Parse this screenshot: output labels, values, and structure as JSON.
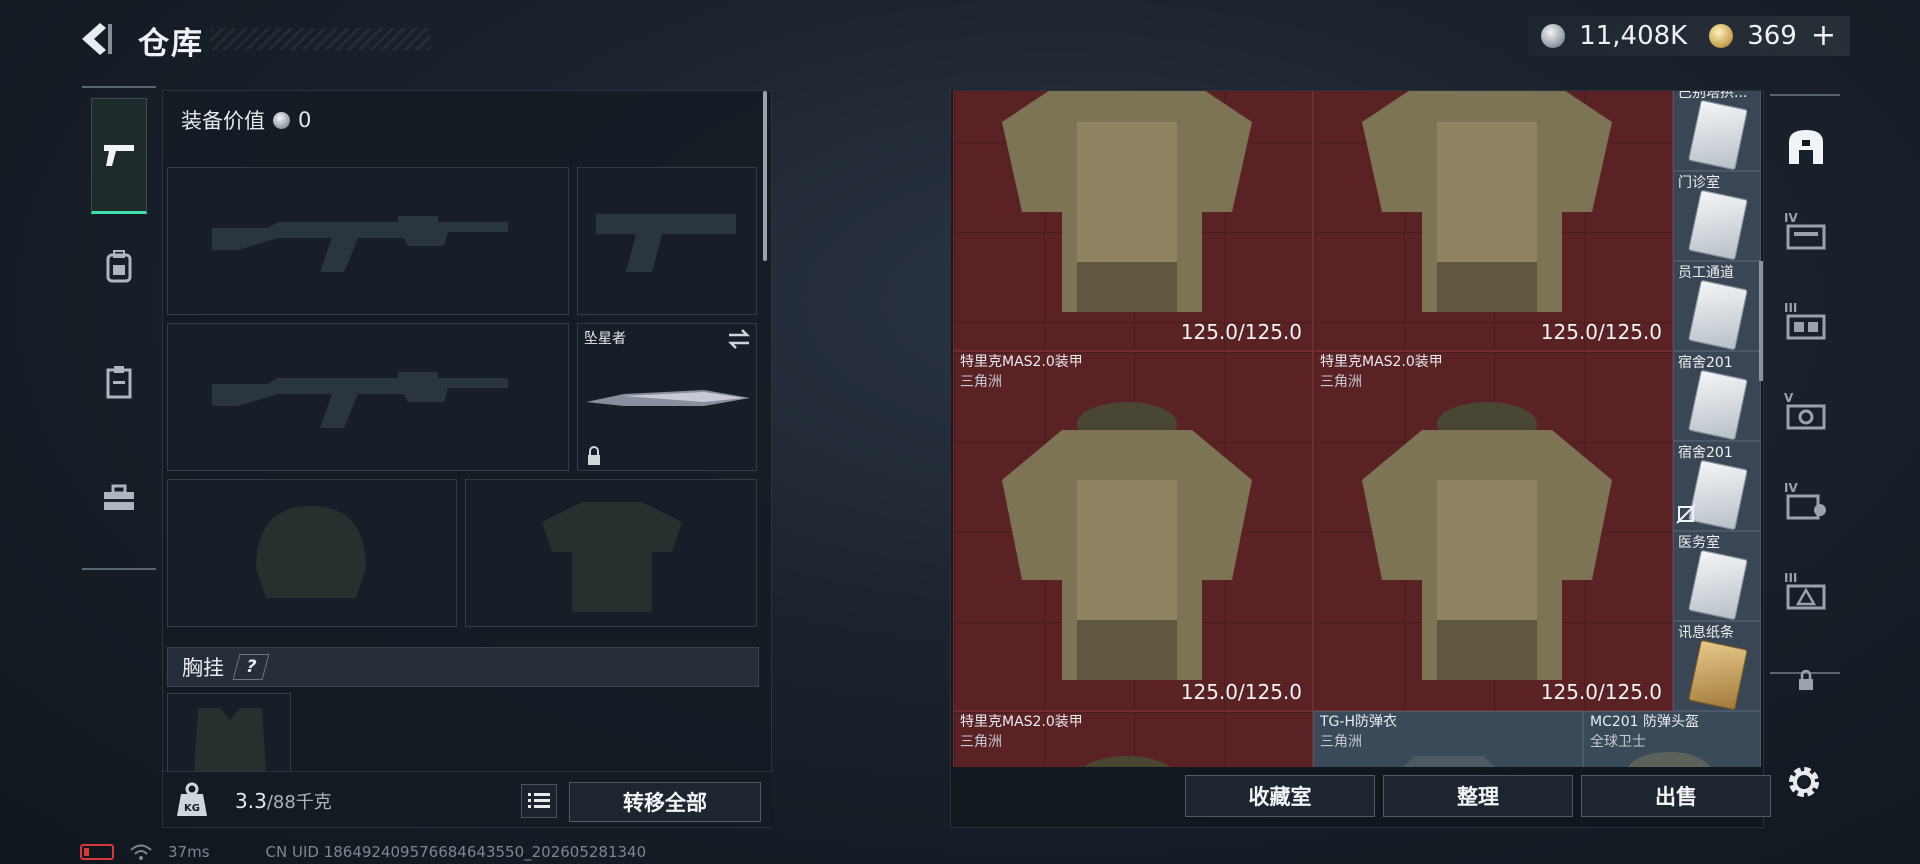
{
  "header": {
    "title": "仓库",
    "currency": [
      {
        "icon": "silver-coin-icon",
        "value": "11,408K"
      },
      {
        "icon": "gold-coin-icon",
        "value": "369"
      }
    ],
    "add_label": "+"
  },
  "left_tabs": [
    {
      "icon": "pistol-icon",
      "active": true
    },
    {
      "icon": "backpack-icon",
      "active": false
    },
    {
      "icon": "clipboard-icon",
      "active": false
    },
    {
      "icon": "toolbox-icon",
      "active": false
    }
  ],
  "loadout": {
    "equip_value_label": "装备价值",
    "equip_value": "0",
    "melee_name": "坠星者",
    "chest_rig_label": "胸挂",
    "help_label": "?",
    "weight_current": "3.3",
    "weight_max": "/88千克",
    "transfer_all_label": "转移全部"
  },
  "stash": {
    "items": [
      {
        "name": "",
        "sub": "",
        "durability": "125.0/125.0"
      },
      {
        "name": "",
        "sub": "",
        "durability": "125.0/125.0"
      },
      {
        "name": "特里克MAS2.0装甲",
        "sub": "三角洲",
        "durability": "125.0/125.0"
      },
      {
        "name": "特里克MAS2.0装甲",
        "sub": "三角洲",
        "durability": "125.0/125.0"
      },
      {
        "name": "特里克MAS2.0装甲",
        "sub": "三角洲",
        "durability": ""
      },
      {
        "name": "TG-H防弹衣",
        "sub": "三角洲",
        "durability": ""
      },
      {
        "name": "MC201 防弹头盔",
        "sub": "全球卫士",
        "durability": ""
      }
    ],
    "keycards": [
      {
        "name": "巴别塔拱..."
      },
      {
        "name": "门诊室"
      },
      {
        "name": "员工通道"
      },
      {
        "name": "宿舍201"
      },
      {
        "name": "宿舍201"
      },
      {
        "name": "医务室"
      },
      {
        "name": "讯息纸条"
      }
    ],
    "buttons": {
      "collection_label": "收藏室",
      "sort_label": "整理",
      "sell_label": "出售"
    }
  },
  "right_tabs": [
    {
      "icon": "stash-home-icon",
      "level": ""
    },
    {
      "icon": "storage-iv-icon",
      "level": "IV"
    },
    {
      "icon": "storage-iii-icon",
      "level": "III"
    },
    {
      "icon": "storage-v-icon",
      "level": "V"
    },
    {
      "icon": "storage-iv-b-icon",
      "level": "IV"
    },
    {
      "icon": "storage-iii-b-icon",
      "level": "III"
    },
    {
      "icon": "lock-icon",
      "level": ""
    }
  ],
  "status_bar": {
    "ping": "37ms",
    "uid": "CN UID 186492409576684643550_202605281340"
  }
}
